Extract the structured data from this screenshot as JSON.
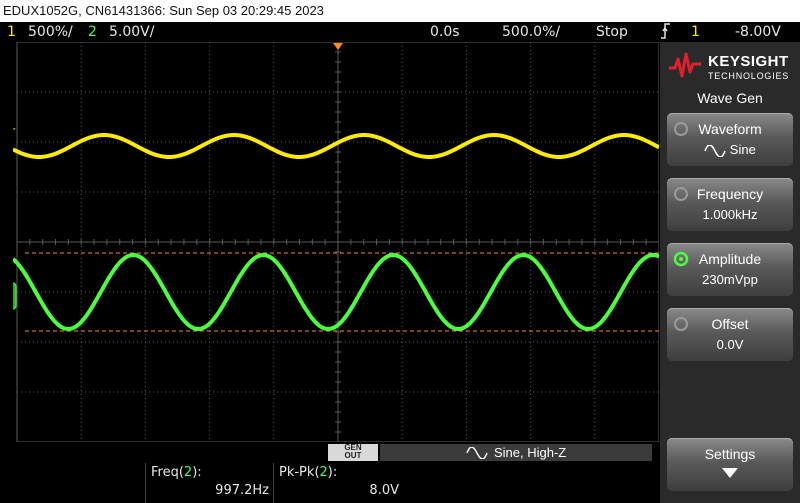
{
  "title_bar": {
    "text": "EDUX1052G, CN61431366: Sun Sep 03 20:29:45 2023"
  },
  "status_bar": {
    "ch1_num": "1",
    "ch1_scale": "500%/",
    "ch2_num": "2",
    "ch2_scale": "5.00V/",
    "time_delay": "0.0s",
    "time_scale": "500.0%/",
    "run_state": "Stop",
    "trigger_icon": "trigger-edge-icon",
    "trigger_channel": "1",
    "trigger_level": "-8.00V"
  },
  "screen": {
    "ch1_marker": "1",
    "ch2_marker": "2",
    "trigger_marker_top": "T",
    "colors": {
      "ch1": "#ffeb00",
      "ch2": "#4cff3c",
      "cursor": "#ff8a1f",
      "grid": "#5a5a5a"
    }
  },
  "panel": {
    "brand_top": "KEYSIGHT",
    "brand_bottom": "TECHNOLOGIES",
    "title": "Wave Gen",
    "softkeys": [
      {
        "label": "Waveform",
        "value": "Sine",
        "icon": "sine-wave-icon"
      },
      {
        "label": "Frequency",
        "value": "1.000kHz"
      },
      {
        "label": "Amplitude",
        "value": "230mVpp",
        "active": true
      },
      {
        "label": "Offset",
        "value": "0.0V"
      },
      {
        "label": "Settings",
        "icon": "down-arrow-icon"
      }
    ]
  },
  "gen_bar": {
    "genout_line1": "GEN",
    "genout_line2": "OUT",
    "message": "Sine, High-Z"
  },
  "measurements": [
    {
      "label": "Freq",
      "channel": "2",
      "value": "997.2Hz"
    },
    {
      "label": "Pk-Pk",
      "channel": "2",
      "value": "8.0V"
    }
  ]
}
